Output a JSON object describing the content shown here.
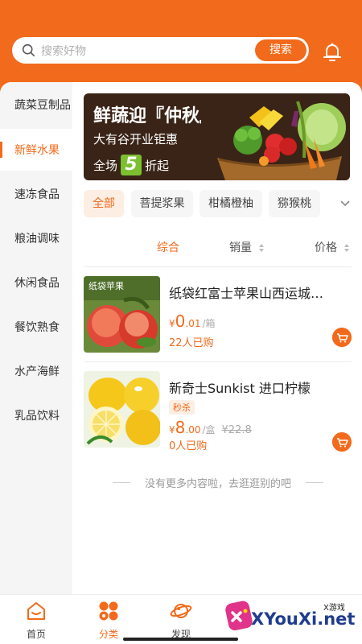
{
  "search": {
    "placeholder": "搜索好物",
    "button": "搜索"
  },
  "sidebar": {
    "items": [
      {
        "label": "蔬菜豆制品",
        "active": false
      },
      {
        "label": "新鲜水果",
        "active": true
      },
      {
        "label": "速冻食品",
        "active": false
      },
      {
        "label": "粮油调味",
        "active": false
      },
      {
        "label": "休闲食品",
        "active": false
      },
      {
        "label": "餐饮熟食",
        "active": false
      },
      {
        "label": "水产海鲜",
        "active": false
      },
      {
        "label": "乳品饮料",
        "active": false
      }
    ]
  },
  "banner": {
    "title": "鲜蔬迎『仲秋』",
    "subtitle": "大有谷开业钜惠",
    "deal_prefix": "全场",
    "deal_num": "5",
    "deal_suffix": "折起"
  },
  "chips": [
    "全部",
    "菩提浆果",
    "柑橘橙柚",
    "猕猴桃"
  ],
  "sort": {
    "composite": "综合",
    "sales": "销量",
    "price": "价格"
  },
  "products": [
    {
      "name": "纸袋红富士苹果山西运城…",
      "image_label": "纸袋苹果",
      "price_currency": "¥",
      "price_int": "0",
      "price_dec": ".01",
      "unit": "/箱",
      "sold": "22人已购"
    },
    {
      "name": "新奇士Sunkist 进口柠檬",
      "tag": "秒杀",
      "price_currency": "¥",
      "price_int": "8",
      "price_dec": ".00",
      "unit": "/盒",
      "old_price": "¥22.8",
      "sold": "0人已购"
    }
  ],
  "end_text": "没有更多内容啦，去逛逛别的吧",
  "nav": [
    "首页",
    "分类",
    "发现"
  ],
  "watermark": {
    "text": "XYouXi.net",
    "small": "X游戏"
  },
  "colors": {
    "accent": "#f26a1b",
    "watermark": "#1f3c8f"
  }
}
